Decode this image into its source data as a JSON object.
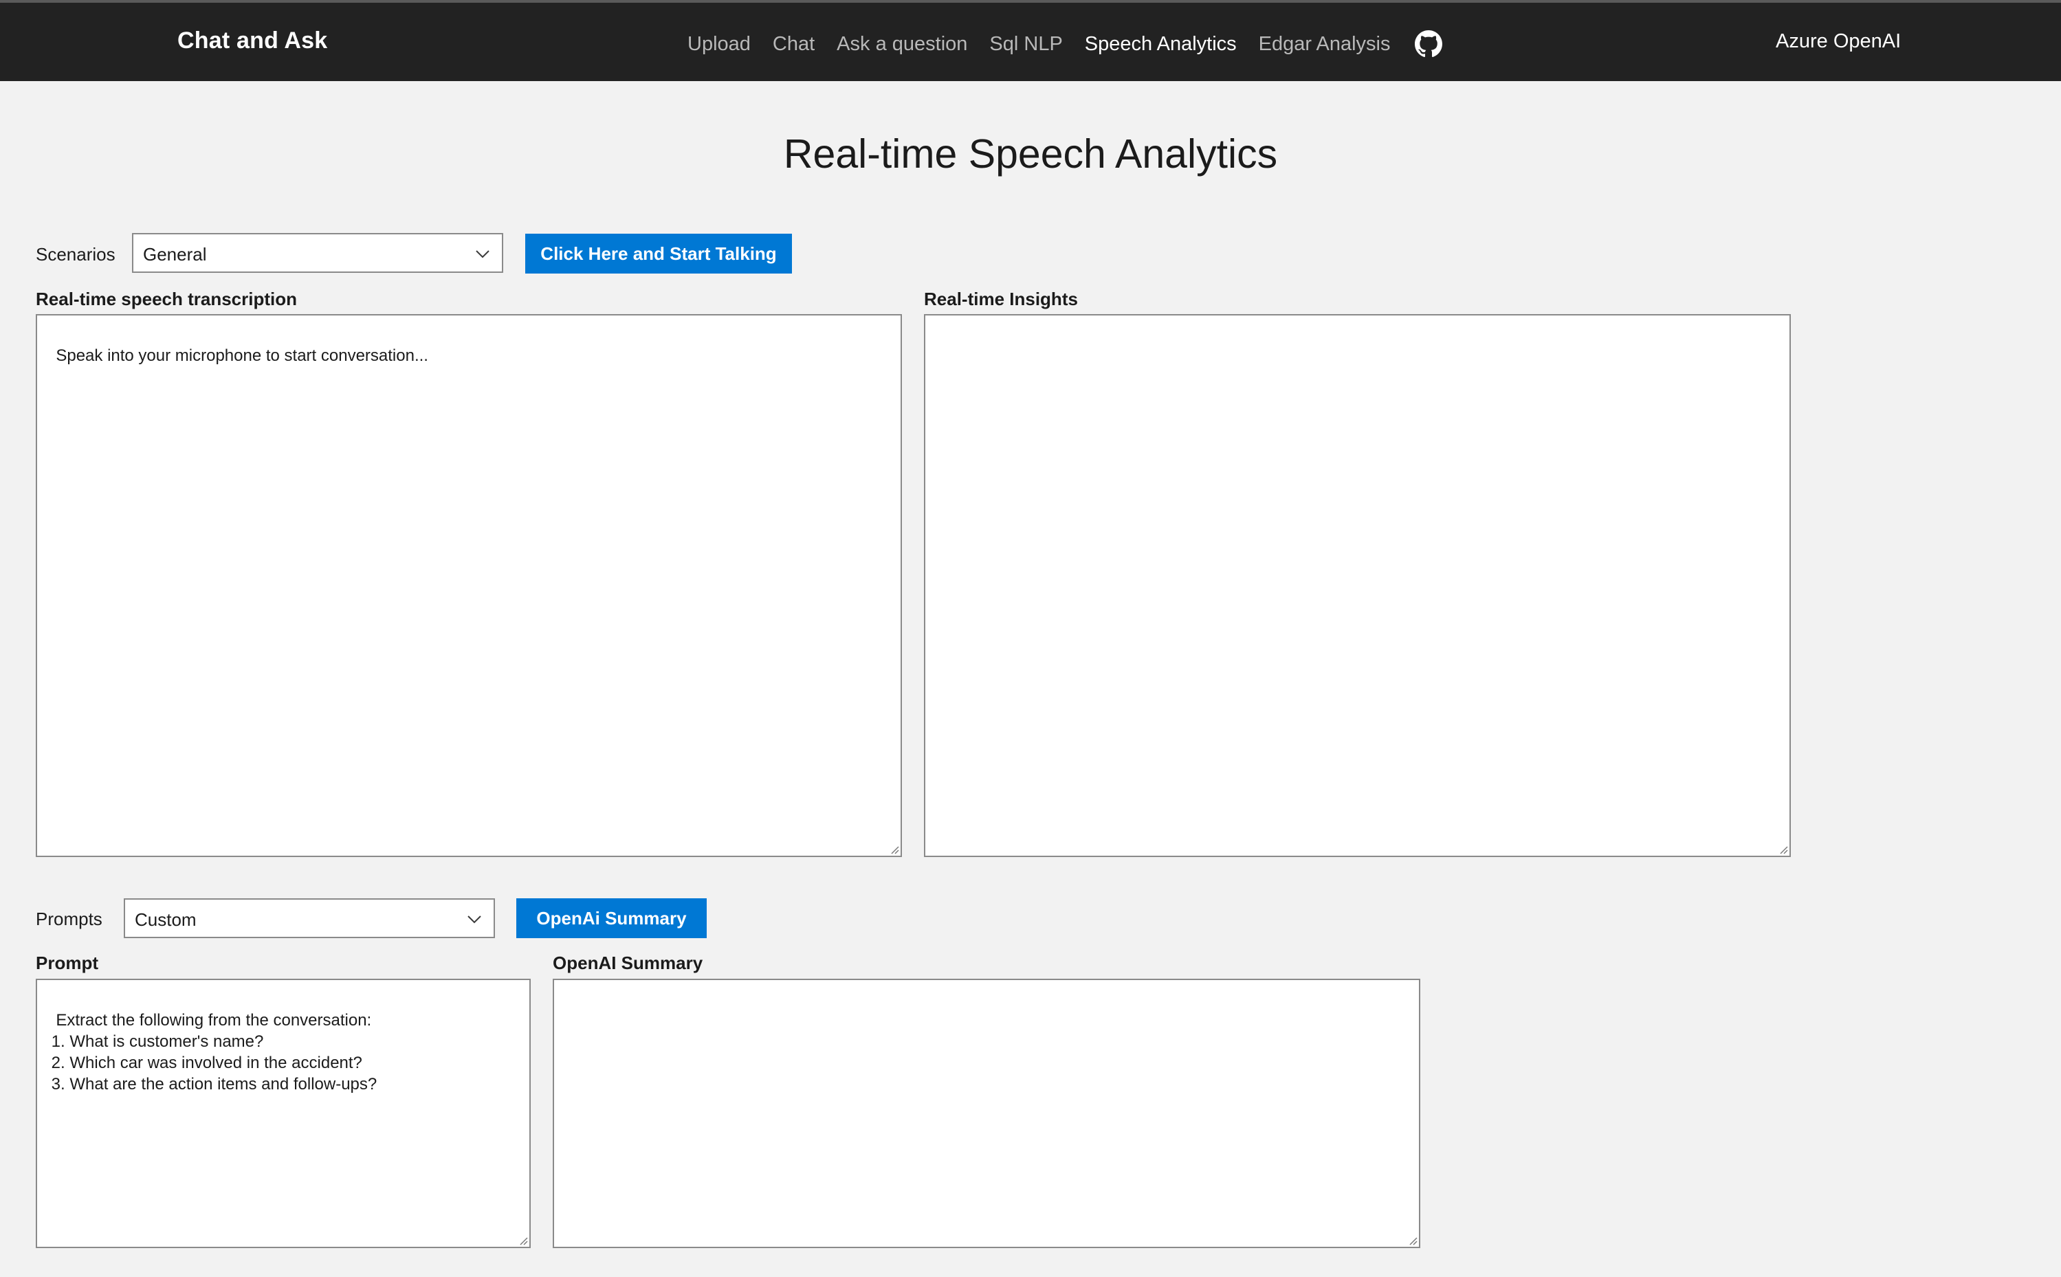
{
  "header": {
    "brand": "Chat and Ask",
    "nav": [
      {
        "label": "Upload",
        "active": false
      },
      {
        "label": "Chat",
        "active": false
      },
      {
        "label": "Ask a question",
        "active": false
      },
      {
        "label": "Sql NLP",
        "active": false
      },
      {
        "label": "Speech Analytics",
        "active": true
      },
      {
        "label": "Edgar Analysis",
        "active": false
      }
    ],
    "github_icon": "github-icon",
    "right_label": "Azure OpenAI"
  },
  "main": {
    "title": "Real-time Speech Analytics",
    "scenarios": {
      "label": "Scenarios",
      "selected": "General",
      "button_label": "Click Here and Start Talking"
    },
    "transcription": {
      "label": "Real-time speech transcription",
      "value": "Speak into your microphone to start conversation..."
    },
    "insights": {
      "label": "Real-time Insights",
      "value": ""
    },
    "prompts": {
      "label": "Prompts",
      "selected": "Custom",
      "button_label": "OpenAi Summary"
    },
    "prompt": {
      "label": "Prompt",
      "value": "Extract the following from the conversation:\n 1. What is customer's name?\n 2. Which car was involved in the accident?\n 3. What are the action items and follow-ups?"
    },
    "summary": {
      "label": "OpenAI Summary",
      "value": ""
    }
  },
  "colors": {
    "navbar": "#222222",
    "page_background": "#f2f2f2",
    "accent_button": "#0078d4"
  }
}
